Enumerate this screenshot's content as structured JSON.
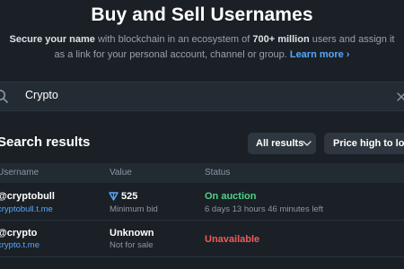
{
  "header": {
    "title": "Buy and Sell Usernames",
    "subtitle": {
      "lead_bold": "Secure your name",
      "text_1": " with blockchain in an ecosystem of ",
      "users_bold": "700+ million",
      "text_2": " users and assign it as a link for your personal account, channel or group. ",
      "learn_more": "Learn more ›"
    }
  },
  "search": {
    "value": "Crypto",
    "search_icon": "search-icon",
    "clear_icon": "close-icon"
  },
  "results": {
    "title": "Search results",
    "filter_all": "All results",
    "sort": "Price high to low"
  },
  "table": {
    "columns": [
      "Username",
      "Value",
      "Status"
    ],
    "rows": [
      {
        "username": "@cryptobull",
        "link": "cryptobull.t.me",
        "value": "525",
        "value_icon": "ton-icon",
        "value_note": "Minimum bid",
        "status": "On auction",
        "status_note": "6 days 13 hours 46 minutes left"
      },
      {
        "username": "@crypto",
        "link": "crypto.t.me",
        "value": "Unknown",
        "value_note": "Not for sale",
        "status": "Unavailable",
        "status_note": ""
      }
    ]
  },
  "colors": {
    "background": "#1a2026",
    "accent_link": "#57a8ff",
    "status_on_auction": "#4fd18b",
    "status_unavailable": "#ef5b5b"
  }
}
